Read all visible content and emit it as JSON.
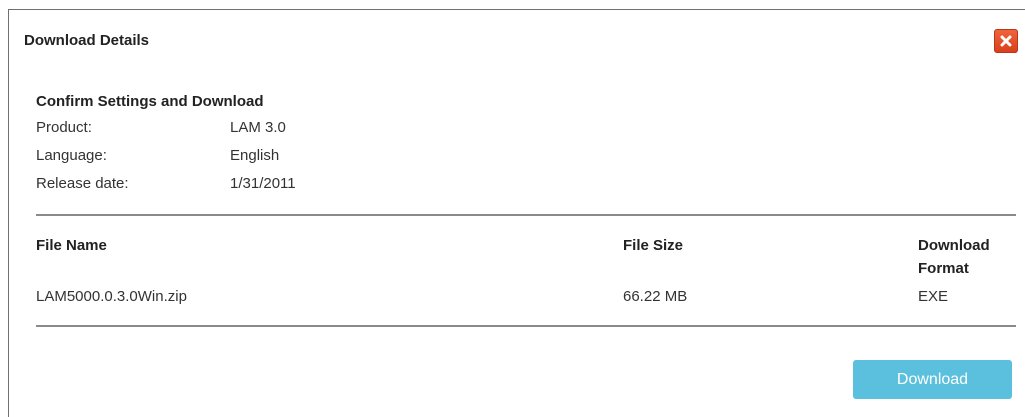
{
  "dialog": {
    "title": "Download Details",
    "close_icon": "close-x-icon",
    "close_color": "#e2482a"
  },
  "settings": {
    "heading": "Confirm Settings and Download",
    "product_label": "Product:",
    "product_value": "LAM 3.0",
    "language_label": "Language:",
    "language_value": "English",
    "release_label": "Release date:",
    "release_value": "1/31/2011"
  },
  "files_table": {
    "headers": {
      "name": "File Name",
      "size": "File Size",
      "format": "Download Format"
    },
    "rows": [
      {
        "name": "LAM5000.0.3.0Win.zip",
        "size": "66.22 MB",
        "format": "EXE"
      }
    ]
  },
  "actions": {
    "download_label": "Download",
    "download_color": "#5bc0de"
  }
}
